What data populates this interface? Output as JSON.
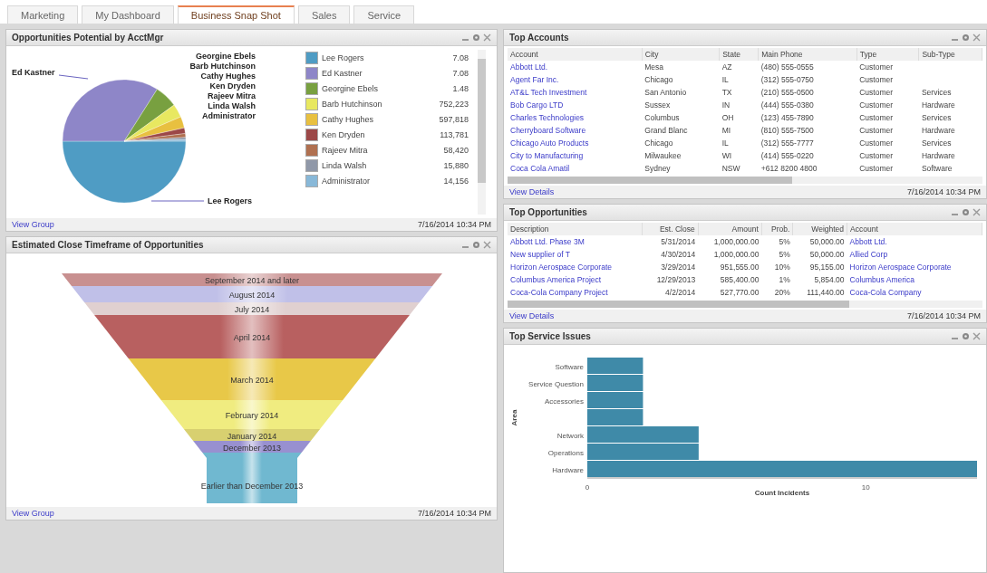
{
  "tabs": [
    {
      "label": "Marketing",
      "selected": false
    },
    {
      "label": "My Dashboard",
      "selected": false
    },
    {
      "label": "Business Snap Shot",
      "selected": true
    },
    {
      "label": "Sales",
      "selected": false
    },
    {
      "label": "Service",
      "selected": false
    }
  ],
  "opportunities_by_user": {
    "title": "Opportunities Potential by AcctMgr",
    "pie_labels": [
      "Ed Kastner",
      "Georgine Ebels",
      "Barb Hutchinson",
      "Cathy Hughes",
      "Ken Dryden",
      "Rajeev Mitra",
      "Linda Walsh",
      "Administrator",
      "Lee Rogers"
    ],
    "legend": [
      {
        "name": "Lee Rogers",
        "value": "7.08",
        "color": "#4f9cc4"
      },
      {
        "name": "Ed Kastner",
        "value": "7.08",
        "color": "#8e86c8"
      },
      {
        "name": "Georgine Ebels",
        "value": "1.48",
        "color": "#78a040"
      },
      {
        "name": "Barb Hutchinson",
        "value": "752,223",
        "color": "#e8e860"
      },
      {
        "name": "Cathy Hughes",
        "value": "597,818",
        "color": "#e8c040"
      },
      {
        "name": "Ken Dryden",
        "value": "113,781",
        "color": "#9c4848"
      },
      {
        "name": "Rajeev Mitra",
        "value": "58,420",
        "color": "#b07050"
      },
      {
        "name": "Linda Walsh",
        "value": "15,880",
        "color": "#9098a8"
      },
      {
        "name": "Administrator",
        "value": "14,156",
        "color": "#88b8d8"
      }
    ],
    "footer_link": "View Group",
    "timestamp": "7/16/2014 10:34 PM"
  },
  "close_timeframe": {
    "title": "Estimated Close Timeframe of Opportunities",
    "stages": [
      {
        "label": "September 2014 and later",
        "color": "#c89090"
      },
      {
        "label": "August 2014",
        "color": "#c0c0e8"
      },
      {
        "label": "July 2014",
        "color": "#e0d0d0"
      },
      {
        "label": "April 2014",
        "color": "#b86060"
      },
      {
        "label": "March 2014",
        "color": "#e8c848"
      },
      {
        "label": "February 2014",
        "color": "#f0ec80"
      },
      {
        "label": "January 2014",
        "color": "#d8d070"
      },
      {
        "label": "December 2013",
        "color": "#9890d0"
      },
      {
        "label": "Earlier than December 2013",
        "color": "#70b8d0"
      }
    ],
    "footer_link": "View Group",
    "timestamp": "7/16/2014 10:34 PM"
  },
  "top_accounts": {
    "title": "Top Accounts",
    "columns": [
      "Account",
      "City",
      "State",
      "Main Phone",
      "Type",
      "Sub-Type"
    ],
    "rows": [
      [
        "Abbott Ltd.",
        "Mesa",
        "AZ",
        "(480) 555-0555",
        "Customer",
        ""
      ],
      [
        "Agent Far Inc.",
        "Chicago",
        "IL",
        "(312) 555-0750",
        "Customer",
        ""
      ],
      [
        "AT&L Tech Investment",
        "San Antonio",
        "TX",
        "(210) 555-0500",
        "Customer",
        "Services"
      ],
      [
        "Bob Cargo LTD",
        "Sussex",
        "IN",
        "(444) 555-0380",
        "Customer",
        "Hardware"
      ],
      [
        "Charles Technologies",
        "Columbus",
        "OH",
        "(123) 455-7890",
        "Customer",
        "Services"
      ],
      [
        "Cherryboard Software",
        "Grand Blanc",
        "MI",
        "(810) 555-7500",
        "Customer",
        "Hardware"
      ],
      [
        "Chicago Auto Products",
        "Chicago",
        "IL",
        "(312) 555-7777",
        "Customer",
        "Services"
      ],
      [
        "City to Manufacturing",
        "Milwaukee",
        "WI",
        "(414) 555-0220",
        "Customer",
        "Hardware"
      ],
      [
        "Coca Cola Amatil",
        "Sydney",
        "NSW",
        "+612 8200 4800",
        "Customer",
        "Software"
      ]
    ],
    "footer_link": "View Details",
    "timestamp": "7/16/2014 10:34 PM"
  },
  "top_opportunities": {
    "title": "Top Opportunities",
    "columns": [
      "Description",
      "Est. Close",
      "Amount",
      "Prob.",
      "Weighted",
      "Account"
    ],
    "rows": [
      [
        "Abbott Ltd. Phase 3M",
        "5/31/2014",
        "1,000,000.00",
        "5%",
        "50,000.00",
        "Abbott Ltd."
      ],
      [
        "New supplier of T",
        "4/30/2014",
        "1,000,000.00",
        "5%",
        "50,000.00",
        "Allied Corp"
      ],
      [
        "Horizon Aerospace Corporate",
        "3/29/2014",
        "951,555.00",
        "10%",
        "95,155.00",
        "Horizon Aerospace Corporate"
      ],
      [
        "Columbus America Project",
        "12/29/2013",
        "585,400.00",
        "1%",
        "5,854.00",
        "Columbus America"
      ],
      [
        "Coca-Cola Company Project",
        "4/2/2014",
        "527,770.00",
        "20%",
        "111,440.00",
        "Coca-Cola Company"
      ]
    ],
    "footer_link": "View Details",
    "timestamp": "7/16/2014 10:34 PM"
  },
  "top_service_issues": {
    "title": "Top Service Issues",
    "chart_data": {
      "type": "bar",
      "orientation": "horizontal",
      "xlabel": "Count Incidents",
      "ylabel": "Area",
      "categories": [
        "Software",
        "Service Question",
        "Accessories",
        null,
        "Network",
        "Operations",
        "Hardware"
      ],
      "series": [
        {
          "color": "#3f8aa8",
          "values": [
            2,
            2,
            2,
            2,
            4,
            4,
            14
          ]
        }
      ],
      "xlim": [
        0,
        14
      ],
      "xticks": [
        0,
        10
      ]
    }
  }
}
